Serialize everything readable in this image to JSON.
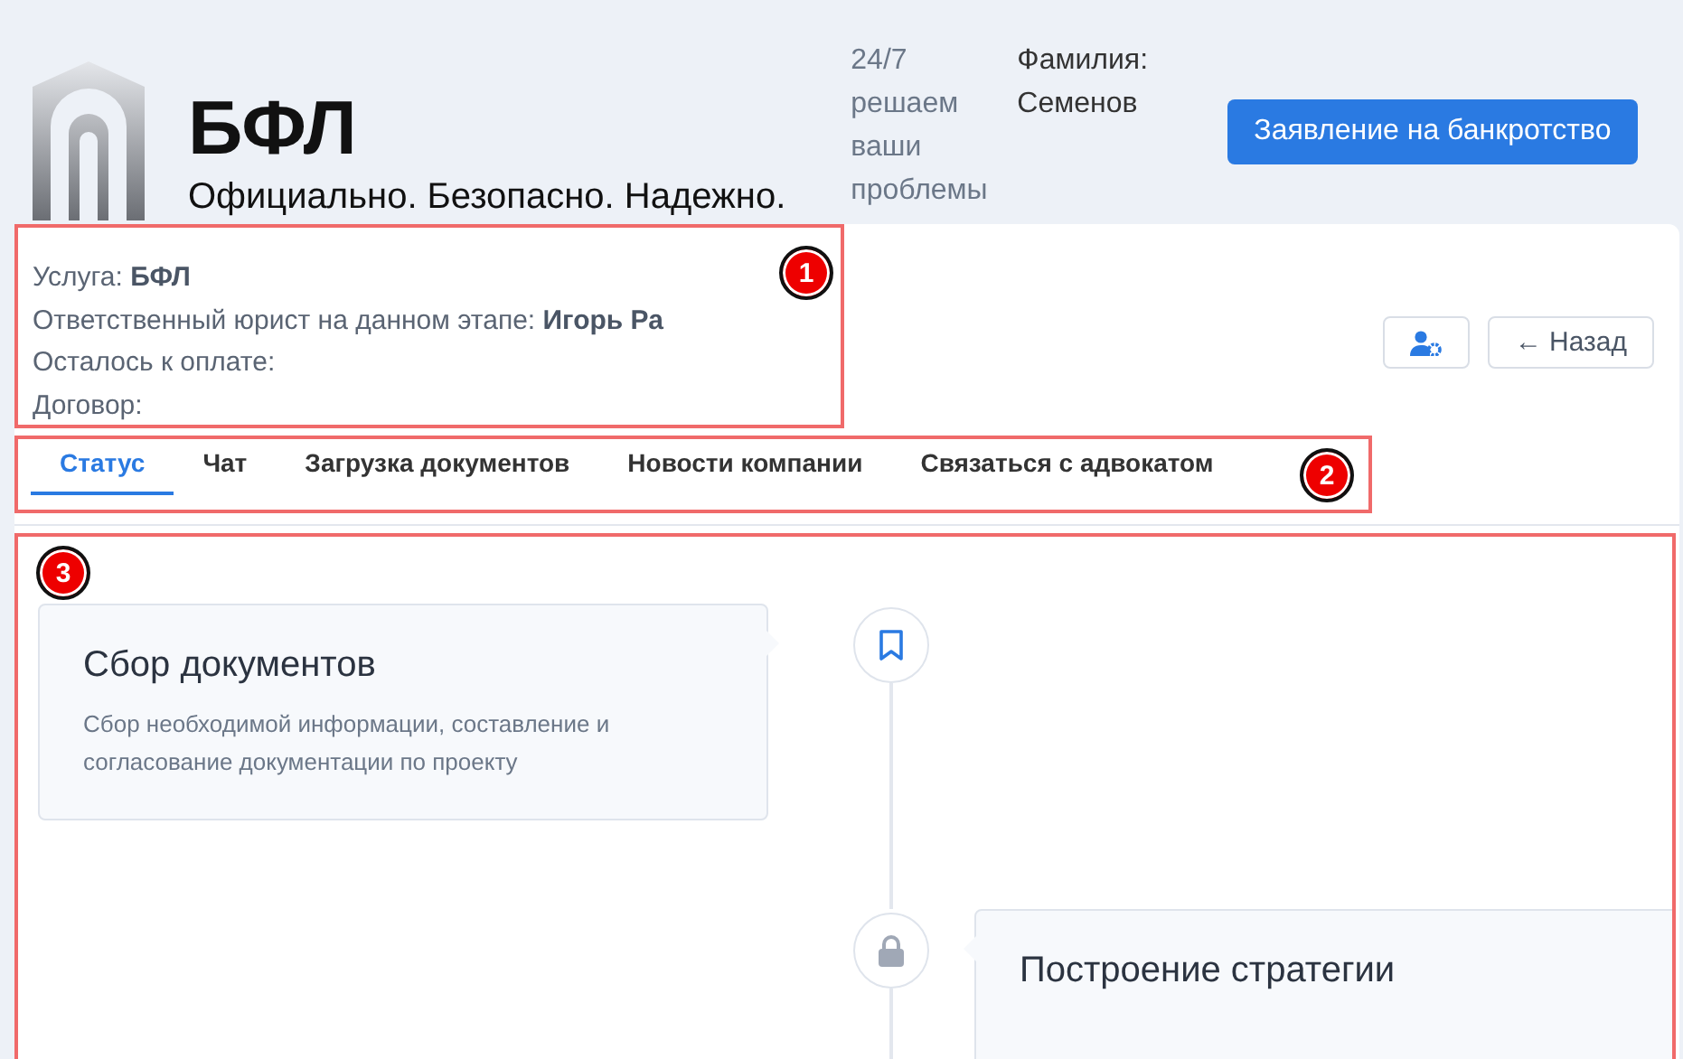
{
  "header": {
    "brand": "БФЛ",
    "tagline": "Официально. Безопасно. Надежно.",
    "support": "24/7 решаем ваши проблемы",
    "surname_label": "Фамилия:",
    "surname": "Семенов",
    "cta": "Заявление на банкротство"
  },
  "info": {
    "annotation": "1",
    "lines": [
      {
        "label": "Услуга:",
        "value": "БФЛ"
      },
      {
        "label": "Ответственный юрист на данном этапе:",
        "value": "Игорь Ра"
      },
      {
        "label": "Осталось к оплате:"
      },
      {
        "label": "Договор:"
      }
    ]
  },
  "actions": {
    "back": "← Назад"
  },
  "tabs": {
    "annotation": "2",
    "items": [
      {
        "label": "Статус",
        "selected": true
      },
      {
        "label": "Чат",
        "selected": false
      },
      {
        "label": "Загрузка документов",
        "selected": false
      },
      {
        "label": "Новости компании",
        "selected": false
      },
      {
        "label": "Связаться с адвокатом",
        "selected": false
      }
    ]
  },
  "timeline": {
    "annotation": "3",
    "steps": [
      {
        "kind": "current",
        "title": "Сбор документов",
        "text": "Сбор необходимой информации, составление и согласование документации по проекту"
      },
      {
        "kind": "locked",
        "title": "Построение стратегии"
      }
    ]
  }
}
